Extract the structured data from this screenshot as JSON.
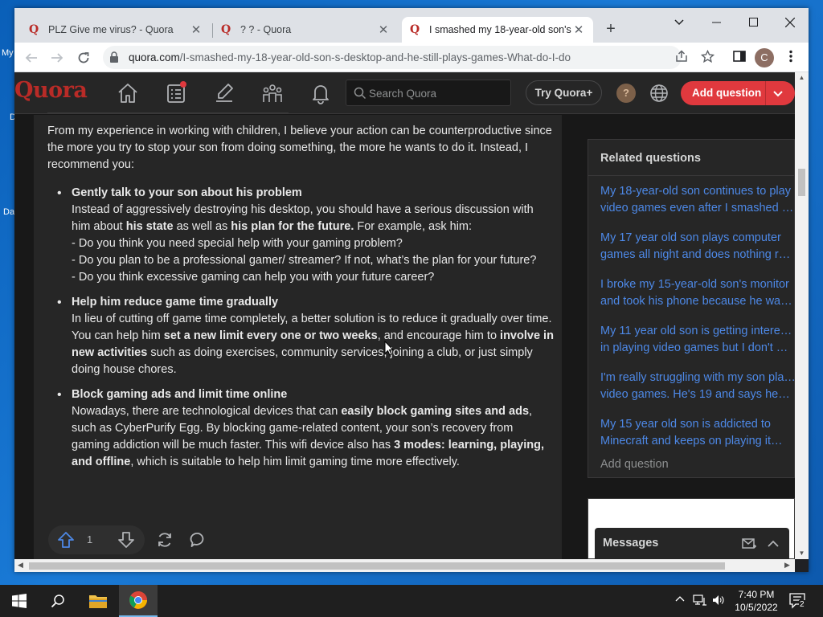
{
  "desktop": {
    "frags": [
      "My",
      "D",
      "Da"
    ]
  },
  "browser": {
    "tabs": [
      {
        "title": "PLZ Give me virus? - Quora",
        "active": false
      },
      {
        "title": "? ? - Quora",
        "active": false
      },
      {
        "title": "I smashed my 18-year-old son's",
        "active": true
      }
    ],
    "url_host": "quora.com",
    "url_path": "/I-smashed-my-18-year-old-son-s-desktop-and-he-still-plays-games-What-do-I-do",
    "profile_initial": "C"
  },
  "quora": {
    "logo": "Quora",
    "search_placeholder": "Search Quora",
    "try_plus": "Try Quora+",
    "profile_initial": "?",
    "add_question": "Add question"
  },
  "answer": {
    "intro": "From my experience in working with children, I believe your action can be counterproductive since the more you try to stop your son from doing something, the more he wants to do it. Instead, I recommend you:",
    "b1_title": "Gently talk to your son about his problem",
    "b1_t1": "Instead of aggressively destroying his desktop, you should have a serious discussion with him about ",
    "b1_b1": "his state",
    "b1_t2": " as well as ",
    "b1_b2": "his plan for the future.",
    "b1_t3": " For example, ask him:",
    "b1_q1": "- Do you think you need special help with your gaming problem?",
    "b1_q2": "- Do you plan to be a professional gamer/ streamer? If not, what’s the plan for your future?",
    "b1_q3": "- Do you think excessive gaming can help you with your future career?",
    "b2_title": "Help him reduce game time gradually",
    "b2_t1": "In lieu of cutting off game time completely, a better solution is to reduce it gradually over time. You can help him ",
    "b2_b1": "set a new limit every one or two weeks",
    "b2_t2": ", and encourage him to ",
    "b2_b2": "involve in new activities",
    "b2_t3": " such as doing exercises, community services, joining a club, or just simply doing house chores.",
    "b3_title": "Block gaming ads and limit time online",
    "b3_t1": "Nowadays, there are technological devices that can ",
    "b3_b1": "easily block gaming sites and ads",
    "b3_t2": ", such as CyberPurify Egg. By blocking game-related content, your son’s recovery from gaming addiction will be much faster. This wifi device also has ",
    "b3_b2": "3 modes: learning, playing, and offline",
    "b3_t3": ", which is suitable to help him limit gaming time more effectively.",
    "upvotes": "1"
  },
  "related": {
    "heading": "Related questions",
    "questions": [
      {
        "l1": "My 18-year-old son continues to play",
        "l2": "video games even after I smashed his"
      },
      {
        "l1": "My 17 year old son plays computer",
        "l2": "games all night and does nothing really"
      },
      {
        "l1": "I broke my 15-year-old son's monitor",
        "l2": "and took his phone because he was…"
      },
      {
        "l1": "My 11 year old son is getting interested",
        "l2": "in playing video games but I don't want"
      },
      {
        "l1": "I'm really struggling with my son playing",
        "l2": "video games. He's 19 and says he…"
      },
      {
        "l1": "My 15 year old son is addicted to",
        "l2": "Minecraft and keeps on playing it…"
      }
    ],
    "add_question": "Add question"
  },
  "messages": {
    "title": "Messages"
  },
  "taskbar": {
    "time": "7:40 PM",
    "date": "10/5/2022",
    "notifications": "2"
  },
  "colors": {
    "quora_red": "#b92b27",
    "link_blue": "#4d88e6",
    "add_button": "#e0393e"
  }
}
